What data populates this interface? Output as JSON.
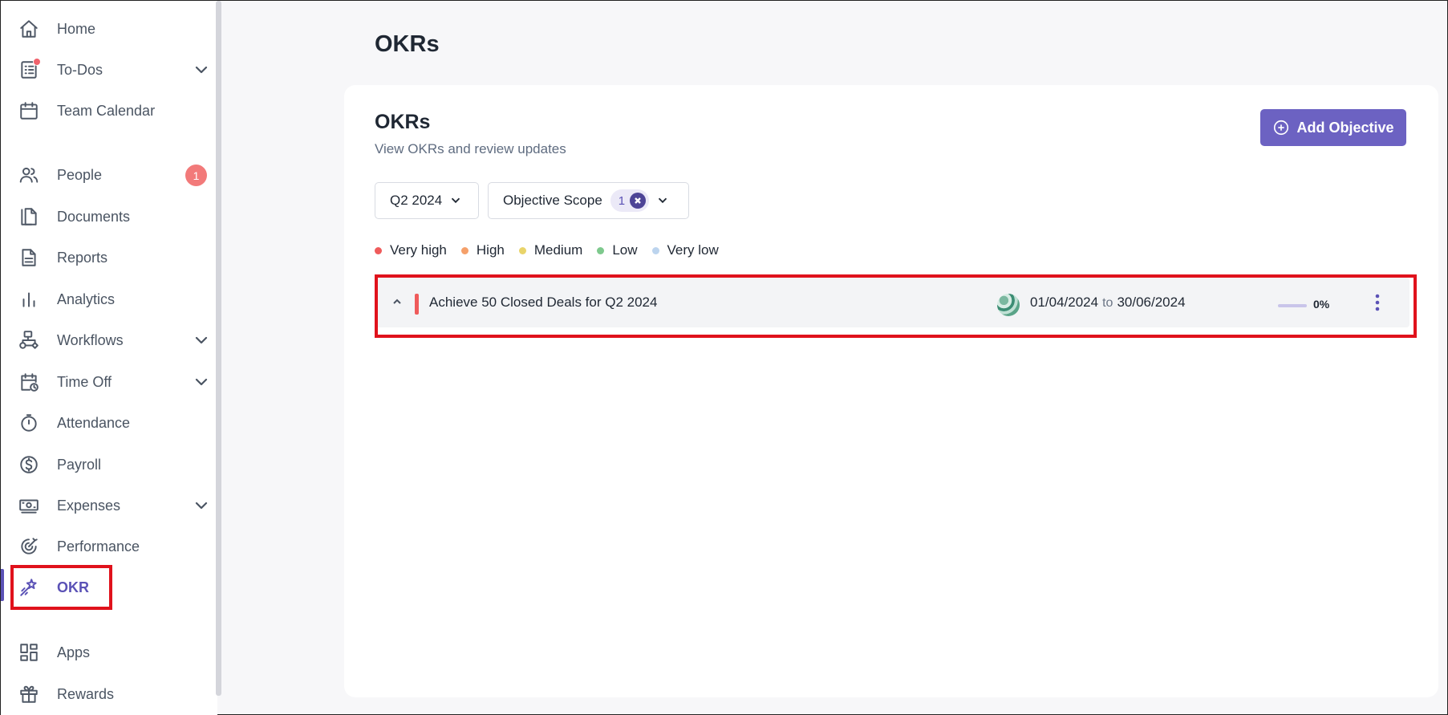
{
  "sidebar": {
    "items": [
      {
        "label": "Home",
        "icon": "home-icon"
      },
      {
        "label": "To-Dos",
        "icon": "todos-icon",
        "has_dropdown": true,
        "notify_dot": true
      },
      {
        "label": "Team Calendar",
        "icon": "calendar-icon"
      },
      {
        "label": "People",
        "icon": "people-icon",
        "badge": "1"
      },
      {
        "label": "Documents",
        "icon": "documents-icon"
      },
      {
        "label": "Reports",
        "icon": "reports-icon"
      },
      {
        "label": "Analytics",
        "icon": "analytics-icon"
      },
      {
        "label": "Workflows",
        "icon": "workflows-icon",
        "has_dropdown": true
      },
      {
        "label": "Time Off",
        "icon": "time-off-icon",
        "has_dropdown": true
      },
      {
        "label": "Attendance",
        "icon": "stopwatch-icon"
      },
      {
        "label": "Payroll",
        "icon": "dollar-icon"
      },
      {
        "label": "Expenses",
        "icon": "money-icon",
        "has_dropdown": true
      },
      {
        "label": "Performance",
        "icon": "performance-icon"
      },
      {
        "label": "OKR",
        "icon": "magic-wand-icon",
        "active": true
      },
      {
        "label": "Apps",
        "icon": "apps-icon"
      },
      {
        "label": "Rewards",
        "icon": "gift-icon"
      }
    ]
  },
  "page": {
    "title": "OKRs"
  },
  "card": {
    "title": "OKRs",
    "subtitle": "View OKRs and review updates",
    "add_button_label": "Add Objective"
  },
  "filters": {
    "quarter": "Q2 2024",
    "scope_label": "Objective Scope",
    "scope_count": "1"
  },
  "legend": [
    {
      "label": "Very high",
      "color": "#ef5b5b"
    },
    {
      "label": "High",
      "color": "#f5a06a"
    },
    {
      "label": "Medium",
      "color": "#e9d46a"
    },
    {
      "label": "Low",
      "color": "#7ec98d"
    },
    {
      "label": "Very low",
      "color": "#bcd4ee"
    }
  ],
  "objective": {
    "title": "Achieve 50 Closed Deals for Q2 2024",
    "priority_color": "#ef5b5b",
    "start_date": "01/04/2024",
    "to_label": "to",
    "end_date": "30/06/2024",
    "progress_value": 0,
    "progress_label": "0%"
  },
  "colors": {
    "accent": "#6c62c2",
    "highlight": "#e0121c"
  }
}
